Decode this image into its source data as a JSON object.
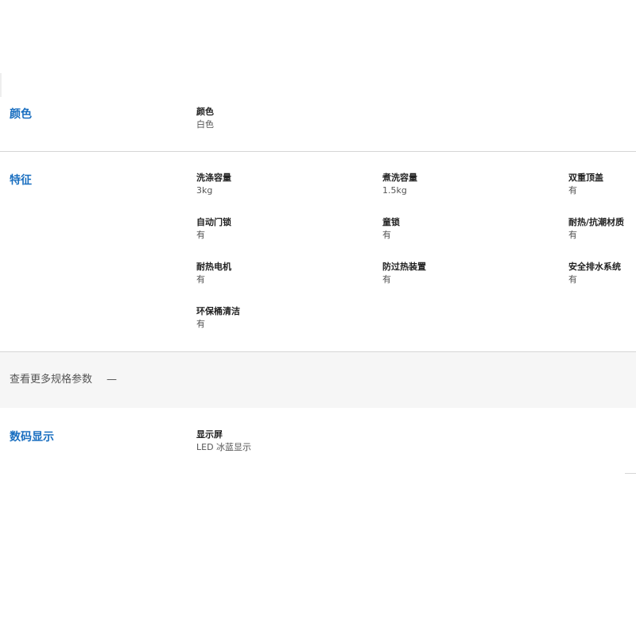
{
  "color_section": {
    "title": "颜色",
    "items": [
      {
        "label": "颜色",
        "value": "白色"
      }
    ]
  },
  "features_section": {
    "title": "特征",
    "items": [
      {
        "label": "洗涤容量",
        "value": "3kg"
      },
      {
        "label": "煮洗容量",
        "value": "1.5kg"
      },
      {
        "label": "双重顶盖",
        "value": "有"
      },
      {
        "label": "自动门锁",
        "value": "有"
      },
      {
        "label": "童锁",
        "value": "有"
      },
      {
        "label": "耐热/抗潮材质",
        "value": "有"
      },
      {
        "label": "耐热电机",
        "value": "有"
      },
      {
        "label": "防过热装置",
        "value": "有"
      },
      {
        "label": "安全排水系统",
        "value": "有"
      },
      {
        "label": "环保桶清洁",
        "value": "有"
      }
    ]
  },
  "more_specs": {
    "label": "查看更多规格参数",
    "toggle_icon": "—"
  },
  "display_section": {
    "title": "数码显示",
    "items": [
      {
        "label": "显示屏",
        "value": "LED 冰蓝显示"
      }
    ]
  },
  "colors": {
    "section_title": "#1a6fc0",
    "divider": "#d6d6d6",
    "more_bar_bg": "#f6f6f6"
  }
}
